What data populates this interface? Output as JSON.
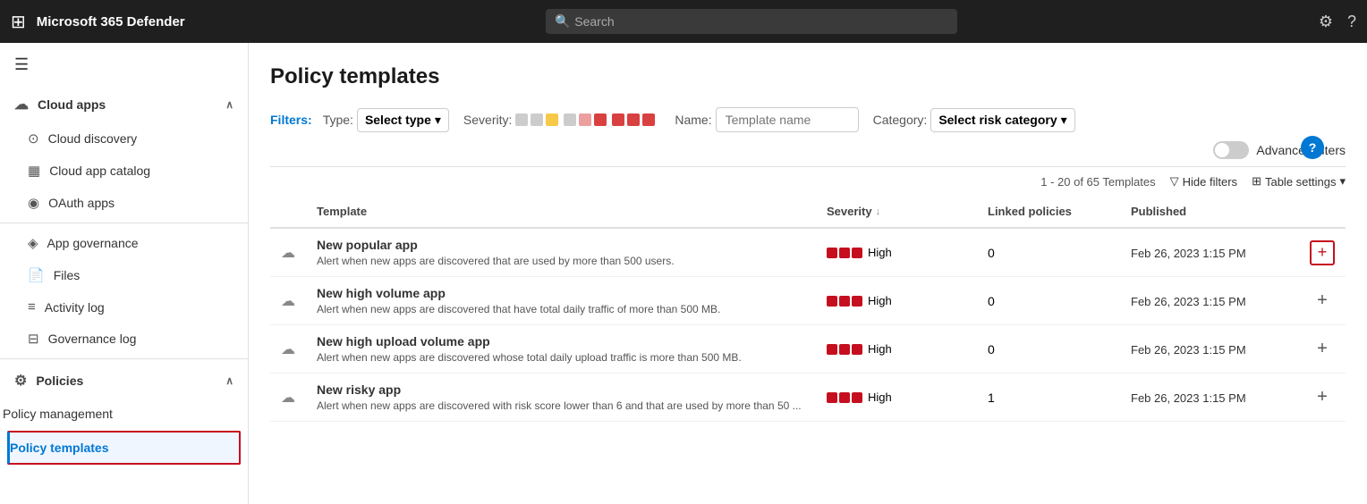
{
  "app": {
    "title": "Microsoft 365 Defender",
    "search_placeholder": "Search"
  },
  "sidebar": {
    "hamburger": "☰",
    "groups": [
      {
        "id": "cloud-apps",
        "label": "Cloud apps",
        "icon": "☁",
        "expanded": true,
        "items": [
          {
            "id": "cloud-discovery",
            "label": "Cloud discovery",
            "icon": "🔍"
          },
          {
            "id": "cloud-app-catalog",
            "label": "Cloud app catalog",
            "icon": "📋"
          },
          {
            "id": "oauth-apps",
            "label": "OAuth apps",
            "icon": "👤"
          }
        ]
      }
    ],
    "standalone_items": [
      {
        "id": "app-governance",
        "label": "App governance",
        "icon": "🛡"
      },
      {
        "id": "files",
        "label": "Files",
        "icon": "📄"
      },
      {
        "id": "activity-log",
        "label": "Activity log",
        "icon": "📝"
      },
      {
        "id": "governance-log",
        "label": "Governance log",
        "icon": "📊"
      }
    ],
    "policies_group": {
      "label": "Policies",
      "icon": "⚙",
      "expanded": true,
      "items": [
        {
          "id": "policy-management",
          "label": "Policy management"
        },
        {
          "id": "policy-templates",
          "label": "Policy templates",
          "active": true
        }
      ]
    }
  },
  "page": {
    "title": "Policy templates",
    "help_label": "?"
  },
  "filters": {
    "label": "Filters:",
    "type_label": "Type:",
    "type_value": "Select type",
    "severity_label": "Severity:",
    "name_label": "Name:",
    "name_placeholder": "Template name",
    "category_label": "Category:",
    "category_value": "Select risk category",
    "advanced_label": "Advanced filters"
  },
  "table": {
    "count_text": "1 - 20 of 65 Templates",
    "hide_filters": "Hide filters",
    "table_settings": "Table settings",
    "columns": [
      {
        "id": "template",
        "label": "Template"
      },
      {
        "id": "severity",
        "label": "Severity",
        "sortable": true
      },
      {
        "id": "linked",
        "label": "Linked policies"
      },
      {
        "id": "published",
        "label": "Published"
      }
    ],
    "rows": [
      {
        "id": 1,
        "name": "New popular app",
        "description": "Alert when new apps are discovered that are used by more than 500 users.",
        "severity": "High",
        "severity_level": 3,
        "linked": "0",
        "published": "Feb 26, 2023 1:15 PM",
        "add_highlighted": true
      },
      {
        "id": 2,
        "name": "New high volume app",
        "description": "Alert when new apps are discovered that have total daily traffic of more than 500 MB.",
        "severity": "High",
        "severity_level": 3,
        "linked": "0",
        "published": "Feb 26, 2023 1:15 PM",
        "add_highlighted": false
      },
      {
        "id": 3,
        "name": "New high upload volume app",
        "description": "Alert when new apps are discovered whose total daily upload traffic is more than 500 MB.",
        "severity": "High",
        "severity_level": 3,
        "linked": "0",
        "published": "Feb 26, 2023 1:15 PM",
        "add_highlighted": false
      },
      {
        "id": 4,
        "name": "New risky app",
        "description": "Alert when new apps are discovered with risk score lower than 6 and that are used by more than 50 ...",
        "severity": "High",
        "severity_level": 3,
        "linked": "1",
        "published": "Feb 26, 2023 1:15 PM",
        "add_highlighted": false
      }
    ]
  }
}
